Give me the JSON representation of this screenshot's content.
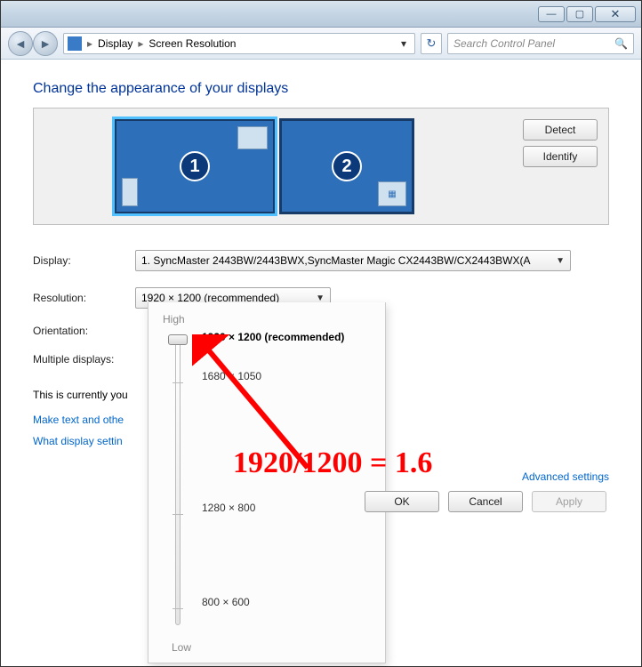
{
  "window": {
    "minimize_tip": "Minimize",
    "maximize_tip": "Maximize",
    "close_tip": "Close"
  },
  "nav": {
    "crumb1": "Display",
    "crumb2": "Screen Resolution",
    "search_placeholder": "Search Control Panel"
  },
  "page": {
    "title": "Change the appearance of your displays"
  },
  "preview": {
    "monitor1_num": "1",
    "monitor2_num": "2",
    "detect_btn": "Detect",
    "identify_btn": "Identify"
  },
  "form": {
    "display_label": "Display:",
    "display_value": "1. SyncMaster 2443BW/2443BWX,SyncMaster Magic CX2443BW/CX2443BWX(A",
    "resolution_label": "Resolution:",
    "resolution_value": "1920 × 1200 (recommended)",
    "orientation_label": "Orientation:",
    "multiple_label": "Multiple displays:",
    "note_text": "This is currently you",
    "link1": "Make text and othe",
    "link2": "What display settin",
    "adv_link": "Advanced settings"
  },
  "slider": {
    "high": "High",
    "low": "Low",
    "opt1": "1920 × 1200 (recommended)",
    "opt2": "1680 × 1050",
    "opt3": "1280 × 800",
    "opt4": "800 × 600"
  },
  "footer": {
    "ok": "OK",
    "cancel": "Cancel",
    "apply": "Apply"
  },
  "annotation": {
    "text": "1920/1200 = 1.6"
  }
}
